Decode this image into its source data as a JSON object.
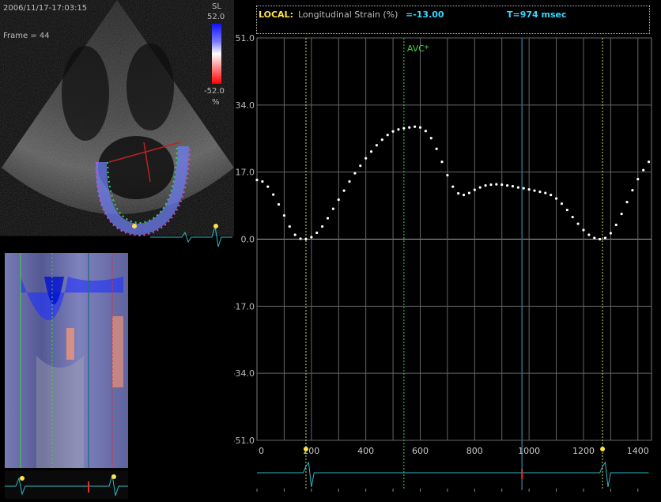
{
  "echo": {
    "timestamp": "2006/11/17-17:03:15",
    "frame": "Frame = 44",
    "scale_title": "SL",
    "scale_max": "52.0",
    "scale_min": "-52.0",
    "scale_unit": "%"
  },
  "header": {
    "mode": "LOCAL:",
    "metric": "Longitudinal Strain (%)",
    "value": "=-13.00",
    "time": "T=974 msec"
  },
  "markers": {
    "avc": "AVC*"
  },
  "chart_data": {
    "type": "scatter",
    "title": "",
    "xlabel": "",
    "ylabel": "",
    "xlim": [
      0,
      1450
    ],
    "ylim": [
      -51,
      51
    ],
    "x_ticks": [
      "0",
      "200",
      "400",
      "600",
      "800",
      "1000",
      "1200",
      "1400"
    ],
    "y_ticks": [
      "51.0",
      "34.0",
      "17.0",
      "0.0",
      "-17.0",
      "-34.0",
      "-51.0"
    ],
    "grid": true,
    "vertical_markers": [
      {
        "x": 180,
        "style": "dotted",
        "color": "#d8d86a"
      },
      {
        "x": 540,
        "style": "dotted",
        "color": "#3ed63e",
        "label": "AVC*"
      },
      {
        "x": 974,
        "style": "solid",
        "color": "#2a6a86"
      },
      {
        "x": 1270,
        "style": "dotted",
        "color": "#d8d86a"
      }
    ],
    "series": [
      {
        "points": [
          [
            0,
            15
          ],
          [
            20,
            14.6
          ],
          [
            40,
            13.3
          ],
          [
            60,
            11.3
          ],
          [
            80,
            8.8
          ],
          [
            100,
            6
          ],
          [
            120,
            3.2
          ],
          [
            140,
            1.1
          ],
          [
            160,
            0.1
          ],
          [
            180,
            0
          ],
          [
            200,
            0.5
          ],
          [
            220,
            1.6
          ],
          [
            240,
            3.2
          ],
          [
            260,
            5.3
          ],
          [
            280,
            7.7
          ],
          [
            300,
            10
          ],
          [
            320,
            12.3
          ],
          [
            340,
            14.6
          ],
          [
            360,
            16.7
          ],
          [
            380,
            18.6
          ],
          [
            400,
            20.5
          ],
          [
            420,
            22.2
          ],
          [
            440,
            23.8
          ],
          [
            460,
            25.2
          ],
          [
            480,
            26.4
          ],
          [
            500,
            27.3
          ],
          [
            520,
            27.8
          ],
          [
            540,
            28.1
          ],
          [
            560,
            28.3
          ],
          [
            580,
            28.5
          ],
          [
            600,
            28.3
          ],
          [
            620,
            27.4
          ],
          [
            640,
            25.6
          ],
          [
            660,
            22.9
          ],
          [
            680,
            19.6
          ],
          [
            700,
            16.2
          ],
          [
            720,
            13.3
          ],
          [
            740,
            11.6
          ],
          [
            760,
            11.2
          ],
          [
            780,
            11.7
          ],
          [
            800,
            12.5
          ],
          [
            820,
            13.1
          ],
          [
            840,
            13.6
          ],
          [
            860,
            13.8
          ],
          [
            880,
            13.9
          ],
          [
            900,
            13.8
          ],
          [
            920,
            13.6
          ],
          [
            940,
            13.4
          ],
          [
            960,
            13.1
          ],
          [
            980,
            12.9
          ],
          [
            1000,
            12.6
          ],
          [
            1020,
            12.3
          ],
          [
            1040,
            12
          ],
          [
            1060,
            11.7
          ],
          [
            1080,
            11.2
          ],
          [
            1100,
            10.3
          ],
          [
            1120,
            9
          ],
          [
            1140,
            7.4
          ],
          [
            1160,
            5.6
          ],
          [
            1180,
            3.9
          ],
          [
            1200,
            2.3
          ],
          [
            1220,
            1.1
          ],
          [
            1240,
            0.3
          ],
          [
            1260,
            0
          ],
          [
            1280,
            0.3
          ],
          [
            1300,
            1.5
          ],
          [
            1320,
            3.6
          ],
          [
            1340,
            6.4
          ],
          [
            1360,
            9.4
          ],
          [
            1380,
            12.4
          ],
          [
            1400,
            15.2
          ],
          [
            1420,
            17.5
          ],
          [
            1440,
            19.6
          ]
        ]
      }
    ]
  }
}
